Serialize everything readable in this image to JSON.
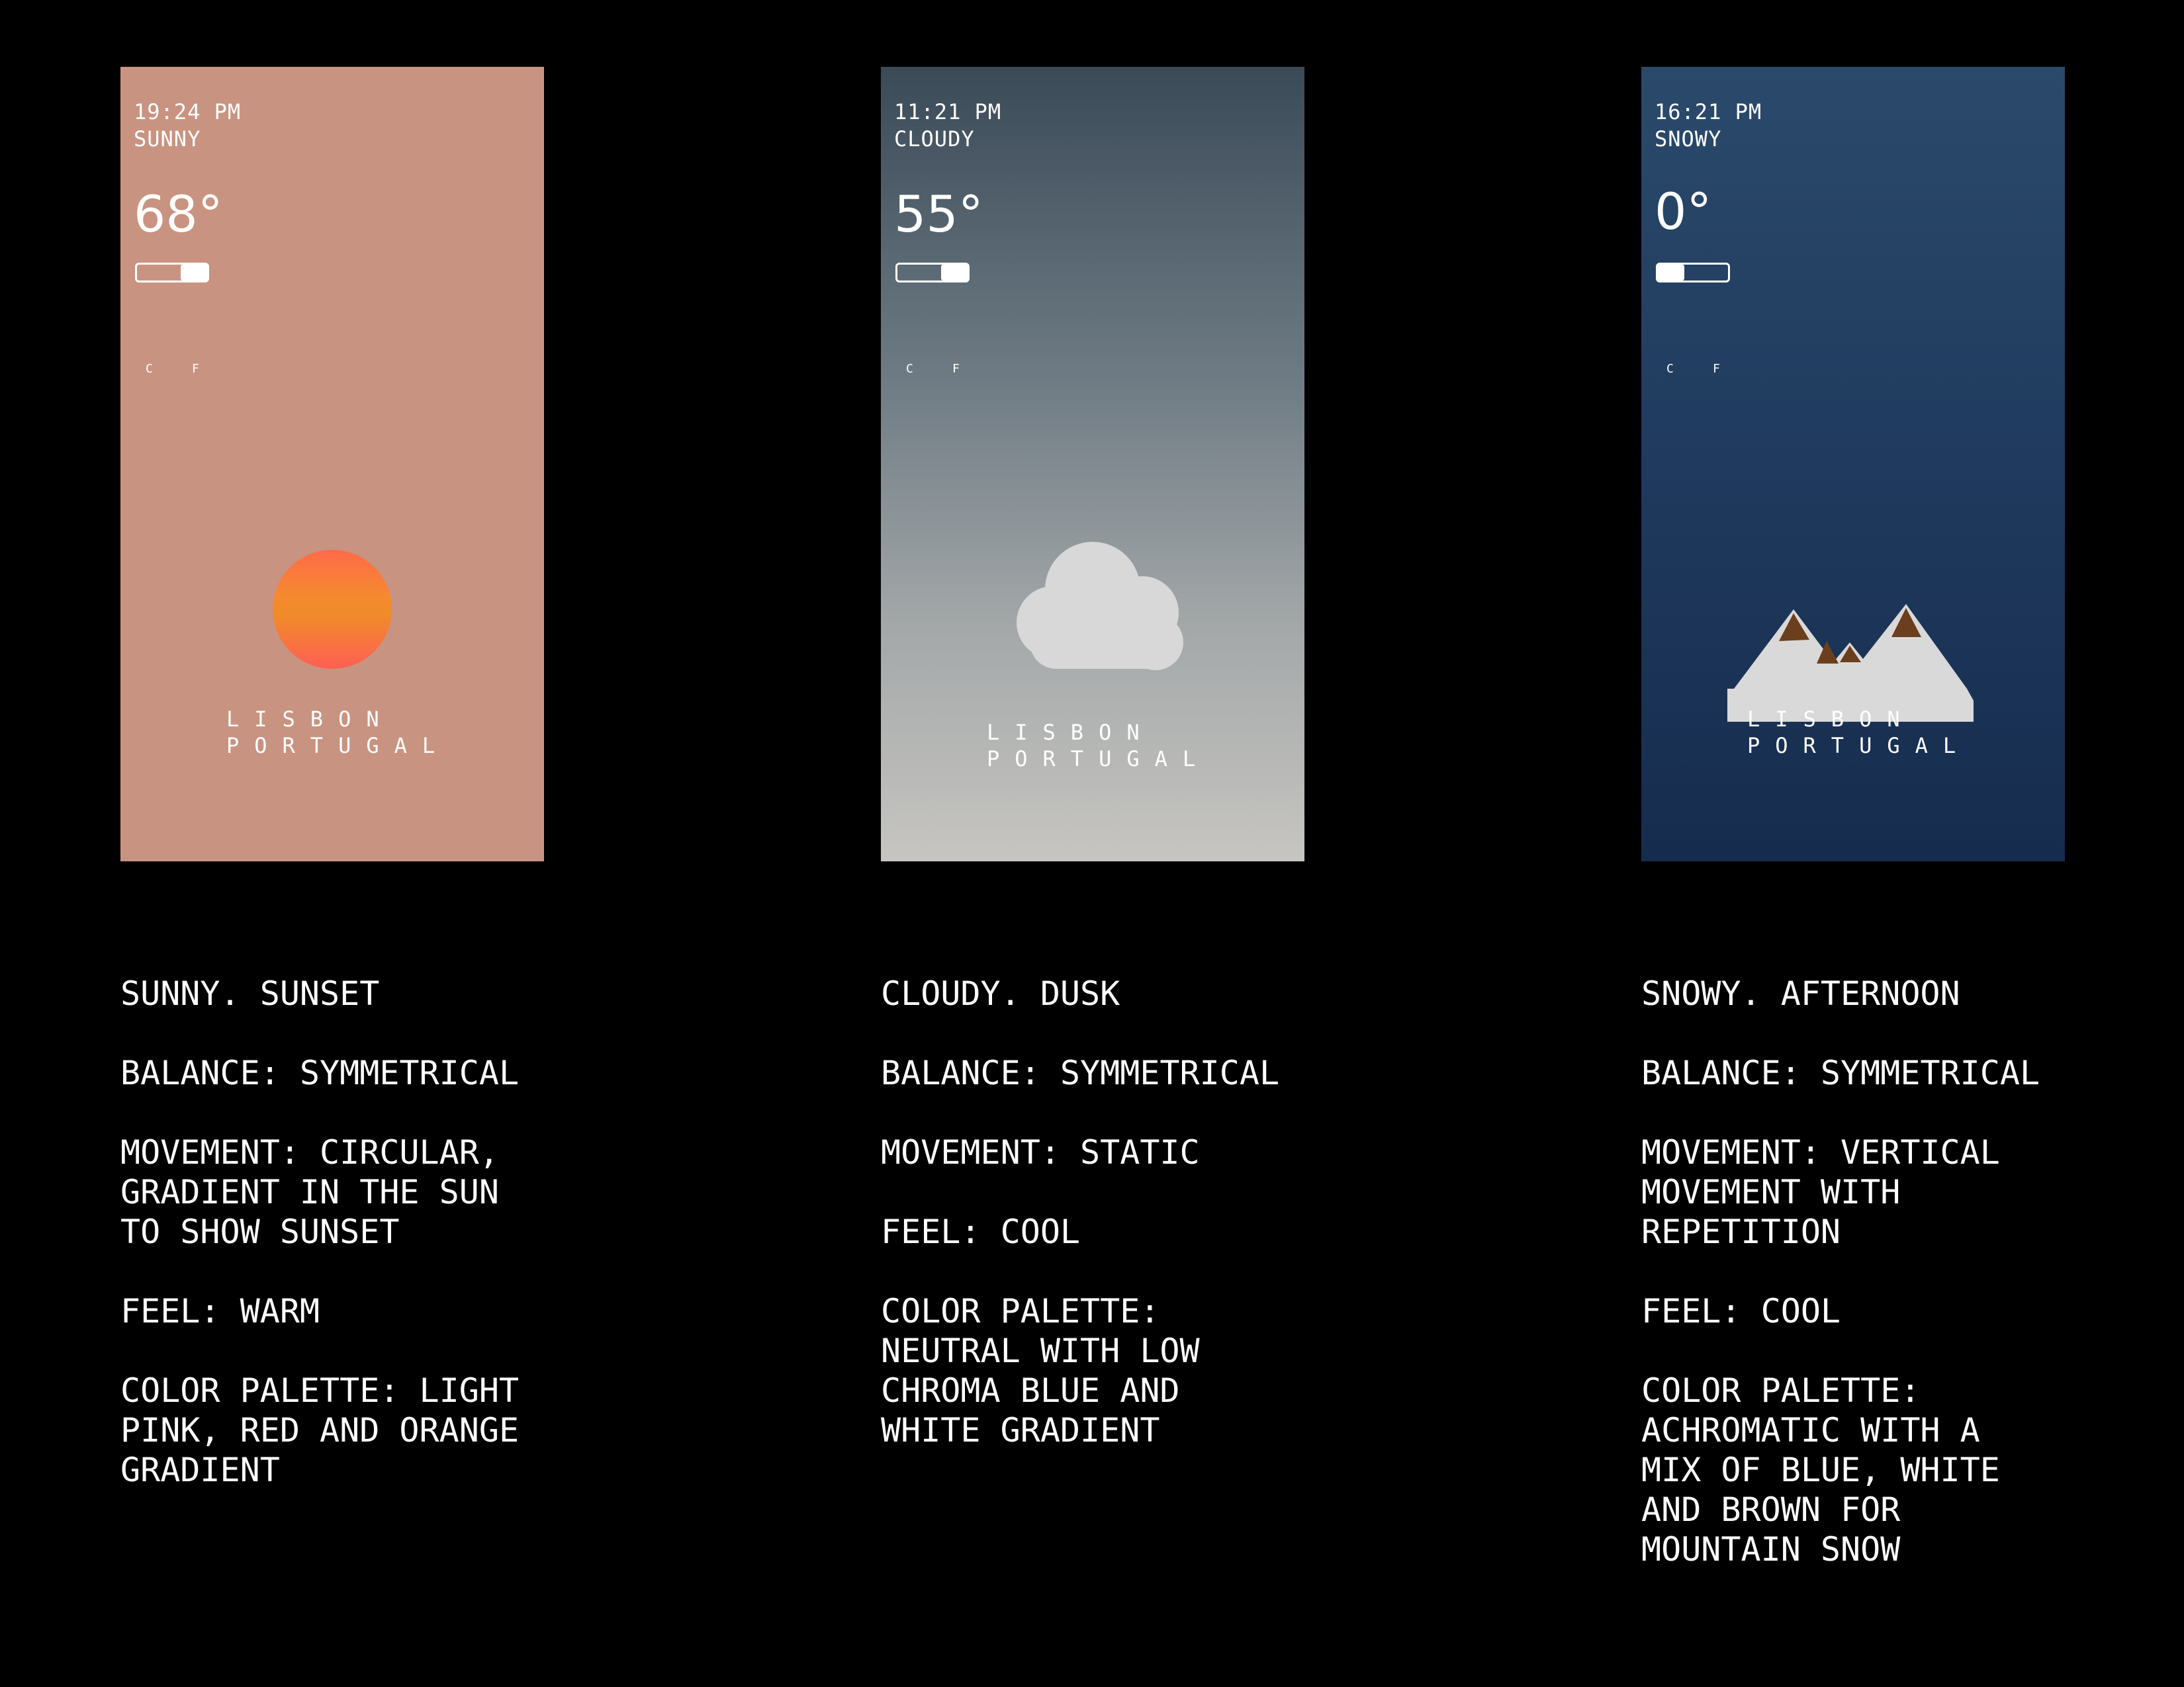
{
  "panels": [
    {
      "time": "19:24 PM",
      "condition": "SUNNY",
      "temperature": "68°",
      "unit_selected": "F",
      "unit_labels": [
        "C",
        "F"
      ],
      "city_line1": "LISBON",
      "city_line2": "PORTUGAL",
      "icon": "sun-icon",
      "background": "#c99381",
      "description": {
        "heading": "SUNNY. SUNSET",
        "balance": "BALANCE: SYMMETRICAL",
        "movement": [
          "MOVEMENT: CIRCULAR,",
          "GRADIENT IN THE SUN",
          "TO SHOW SUNSET"
        ],
        "feel": "FEEL: WARM",
        "palette": [
          "COLOR PALETTE: LIGHT",
          "PINK, RED AND ORANGE",
          "GRADIENT"
        ]
      }
    },
    {
      "time": "11:21 PM",
      "condition": "CLOUDY",
      "temperature": "55°",
      "unit_selected": "F",
      "unit_labels": [
        "C",
        "F"
      ],
      "city_line1": "LISBON",
      "city_line2": "PORTUGAL",
      "icon": "cloud-icon",
      "background": "#3a4a57",
      "description": {
        "heading": "CLOUDY. DUSK",
        "balance": "BALANCE: SYMMETRICAL",
        "movement": [
          "MOVEMENT: STATIC"
        ],
        "feel": "FEEL: COOL",
        "palette": [
          "COLOR PALETTE:",
          "NEUTRAL WITH LOW",
          "CHROMA BLUE AND",
          "WHITE GRADIENT"
        ]
      }
    },
    {
      "time": "16:21 PM",
      "condition": "SNOWY",
      "temperature": "0°",
      "unit_selected": "C",
      "unit_labels": [
        "C",
        "F"
      ],
      "city_line1": "LISBON",
      "city_line2": "PORTUGAL",
      "icon": "mountain-icon",
      "background": "#1f3a5e",
      "description": {
        "heading": "SNOWY. AFTERNOON",
        "balance": "BALANCE: SYMMETRICAL",
        "movement": [
          "MOVEMENT: VERTICAL",
          "MOVEMENT WITH",
          "REPETITION"
        ],
        "feel": "FEEL: COOL",
        "palette": [
          "COLOR PALETTE:",
          "ACHROMATIC WITH A",
          "MIX OF BLUE, WHITE",
          "AND BROWN FOR",
          "MOUNTAIN SNOW"
        ]
      }
    }
  ]
}
